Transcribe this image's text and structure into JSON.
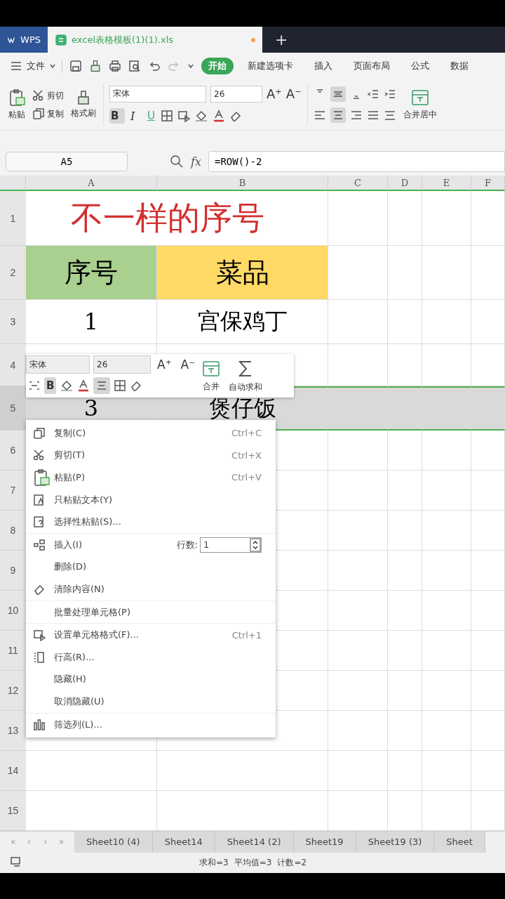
{
  "app_tabs": [
    {
      "label": "WPS",
      "kind": "home",
      "selected": false
    },
    {
      "label": "excel表格模板(1)(1).xls",
      "kind": "file",
      "selected": true,
      "unsaved": true
    }
  ],
  "new_tab": "+",
  "menu": {
    "file": "文件",
    "tabs": [
      {
        "label": "开始",
        "selected": true
      },
      {
        "label": "新建选项卡",
        "selected": false
      },
      {
        "label": "插入",
        "selected": false
      },
      {
        "label": "页面布局",
        "selected": false
      },
      {
        "label": "公式",
        "selected": false
      },
      {
        "label": "数据",
        "selected": false
      }
    ]
  },
  "ribbon": {
    "grow_font": "A⁺",
    "shrink_font": "A⁻",
    "bold_label": "B",
    "italic_label": "I",
    "underline_label": "U",
    "paste": "粘贴",
    "cut": "剪切",
    "copy": "复制",
    "format_painter": "格式刷",
    "font": "宋体",
    "size": "26",
    "bold": true,
    "italic": false,
    "underline": false,
    "align_center": true,
    "merge": "合并居中"
  },
  "formula_bar": {
    "name_box": "A5",
    "fx": "fx",
    "formula": "=ROW()-2"
  },
  "columns": [
    "A",
    "B",
    "C",
    "D",
    "E",
    "F"
  ],
  "rows": [
    {
      "number": "1",
      "selected": false,
      "cells": [
        {
          "text": "不一样的序号",
          "kind": "title"
        }
      ]
    },
    {
      "number": "2",
      "selected": false,
      "cells": [
        {
          "text": "序号",
          "kind": "header",
          "color": "#a9d08e"
        },
        {
          "text": "菜品",
          "kind": "header",
          "color": "#ffd966"
        }
      ]
    },
    {
      "number": "3",
      "selected": false,
      "cells": [
        {
          "text": "1",
          "kind": "value"
        },
        {
          "text": "宫保鸡丁",
          "kind": "value"
        }
      ]
    },
    {
      "number": "4",
      "selected": false,
      "cells": []
    },
    {
      "number": "5",
      "selected": true,
      "cells": [
        {
          "text": "3",
          "kind": "value"
        },
        {
          "text": "煲仔饭",
          "kind": "value"
        }
      ]
    },
    {
      "number": "6",
      "selected": false
    },
    {
      "number": "7",
      "selected": false
    },
    {
      "number": "8",
      "selected": false
    },
    {
      "number": "9",
      "selected": false
    },
    {
      "number": "10",
      "selected": false
    },
    {
      "number": "11",
      "selected": false
    },
    {
      "number": "12",
      "selected": false
    },
    {
      "number": "13",
      "selected": false
    },
    {
      "number": "14",
      "selected": false
    },
    {
      "number": "15",
      "selected": false
    }
  ],
  "mini_toolbar": {
    "grow_font": "A⁺",
    "shrink_font": "A⁻",
    "bold_label": "B",
    "font": "宋体",
    "size": "26",
    "bold": true,
    "align_center": true,
    "merge": "合并",
    "autosum": "自动求和"
  },
  "context_menu": [
    {
      "label": "复制(C)",
      "shortcut": "Ctrl+C",
      "divider_after": false
    },
    {
      "label": "剪切(T)",
      "shortcut": "Ctrl+X",
      "divider_after": false
    },
    {
      "label": "粘贴(P)",
      "shortcut": "Ctrl+V",
      "divider_after": false
    },
    {
      "label": "只粘贴文本(Y)",
      "divider_after": false
    },
    {
      "label": "选择性粘贴(S)...",
      "divider_after": true
    },
    {
      "label": "插入(I)",
      "field_label": "行数:",
      "field_value": "1",
      "divider_after": false
    },
    {
      "label": "删除(D)",
      "divider_after": false
    },
    {
      "label": "清除内容(N)",
      "divider_after": true
    },
    {
      "label": "批量处理单元格(P)",
      "divider_after": true
    },
    {
      "label": "设置单元格格式(F)...",
      "shortcut": "Ctrl+1",
      "divider_after": false
    },
    {
      "label": "行高(R)...",
      "divider_after": false
    },
    {
      "label": "隐藏(H)",
      "divider_after": false
    },
    {
      "label": "取消隐藏(U)",
      "divider_after": true
    },
    {
      "label": "筛选列(L)...",
      "divider_after": false
    }
  ],
  "sheet_tabs": [
    {
      "label": "Sheet10 (4)",
      "selected": false
    },
    {
      "label": "Sheet14",
      "selected": false
    },
    {
      "label": "Sheet14 (2)",
      "selected": false
    },
    {
      "label": "Sheet19",
      "selected": false
    },
    {
      "label": "Sheet19 (3)",
      "selected": false
    },
    {
      "label": "Sheet",
      "selected": false
    }
  ],
  "status_bar": [
    "求和=3",
    "平均值=3",
    "计数=2"
  ]
}
